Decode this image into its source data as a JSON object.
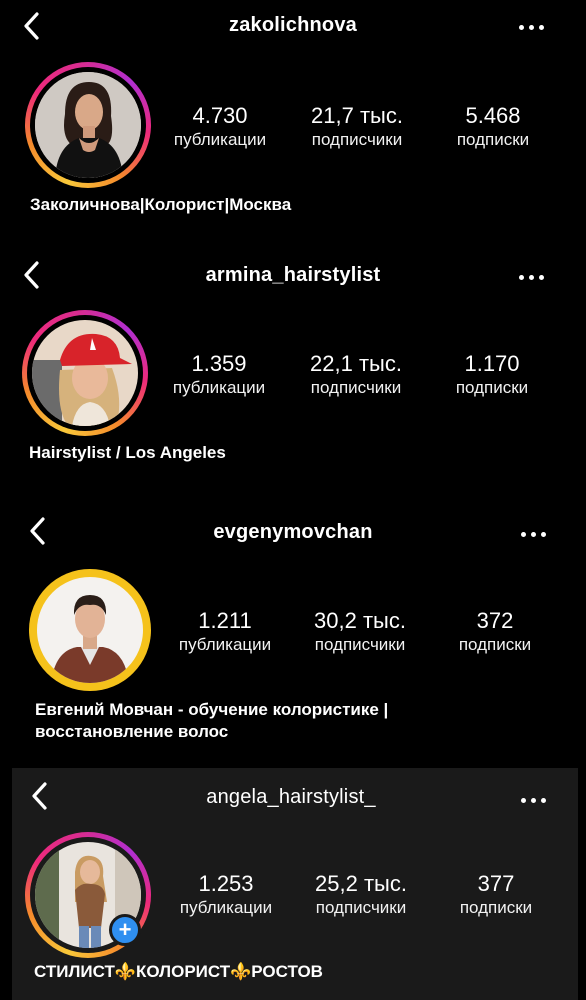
{
  "profiles": [
    {
      "username": "zakolichnova",
      "posts": "4.730",
      "posts_label": "публикации",
      "followers": "21,7 тыс.",
      "followers_label": "подписчики",
      "following": "5.468",
      "following_label": "подписки",
      "bio": "Заколичнова|Колорист|Москва"
    },
    {
      "username": "armina_hairstylist",
      "posts": "1.359",
      "posts_label": "публикации",
      "followers": "22,1 тыс.",
      "followers_label": "подписчики",
      "following": "1.170",
      "following_label": "подписки",
      "bio": "Hairstylist / Los Angeles"
    },
    {
      "username": "evgenymovchan",
      "posts": "1.211",
      "posts_label": "публикации",
      "followers": "30,2 тыс.",
      "followers_label": "подписчики",
      "following": "372",
      "following_label": "подписки",
      "bio_line1": "Евгений Мовчан - обучение колористике |",
      "bio_line2": "восстановление волос"
    },
    {
      "username": "angela_hairstylist_",
      "posts": "1.253",
      "posts_label": "публикации",
      "followers": "25,2 тыс.",
      "followers_label": "подписчики",
      "following": "377",
      "following_label": "подписки",
      "bio": "СТИЛИСТ⚜️КОЛОРИСТ⚜️РОСТОВ",
      "add_story": "+"
    }
  ],
  "colors": {
    "background": "#000000",
    "panel_highlight": "#1a1a1a",
    "story_ring_gradient": [
      "#f9c83a",
      "#ee2a7b",
      "#b02fd0"
    ],
    "story_ring_close_friends": "#f5c21b",
    "add_badge": "#2f8ff0"
  },
  "icons": {
    "back": "chevron-left-icon",
    "more": "more-horizontal-icon",
    "add_story": "plus-icon"
  }
}
